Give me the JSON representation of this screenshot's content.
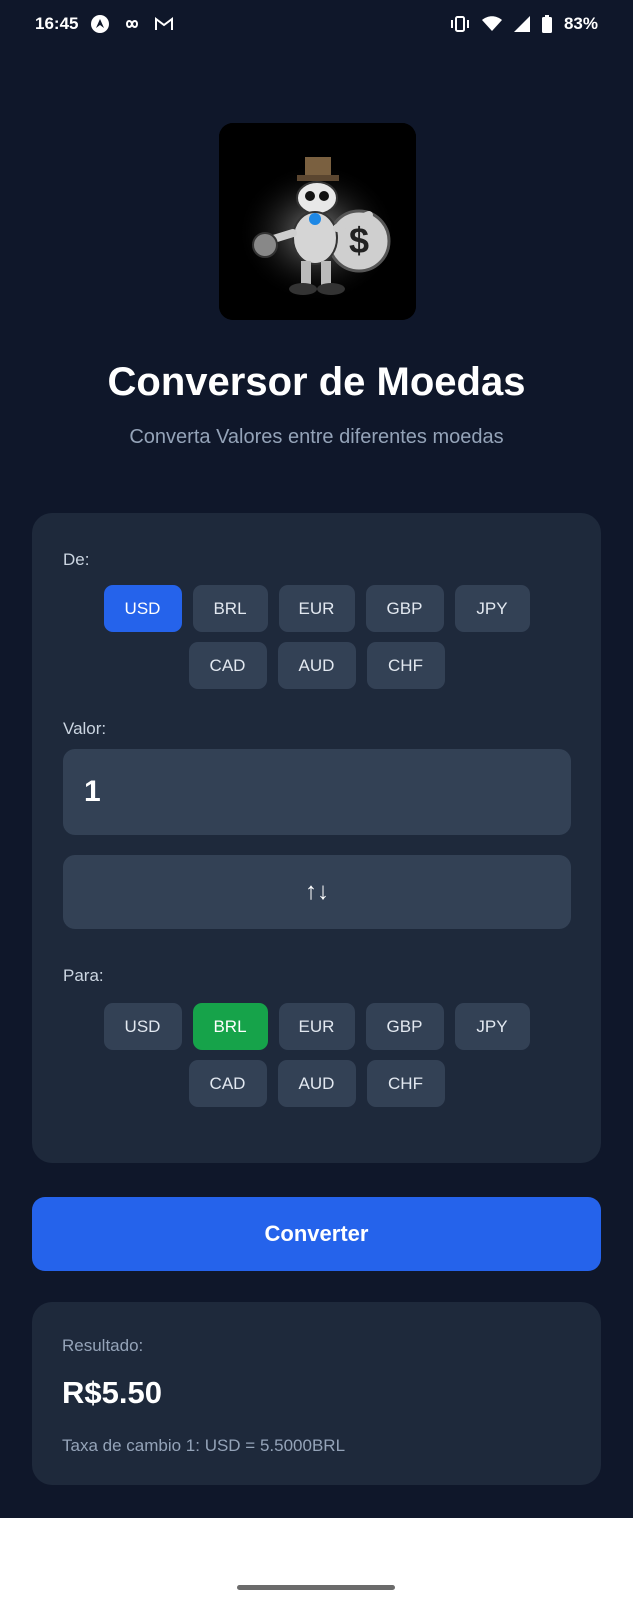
{
  "status_bar": {
    "time": "16:45",
    "battery": "83%",
    "left_icons": [
      "android-auto-icon",
      "infinity-icon",
      "gmail-icon"
    ],
    "right_icons": [
      "vibrate-icon",
      "wifi-icon",
      "signal-icon",
      "battery-icon"
    ]
  },
  "header": {
    "title": "Conversor de Moedas",
    "subtitle": "Converta Valores entre diferentes moedas"
  },
  "converter": {
    "from_label": "De:",
    "to_label": "Para:",
    "value_label": "Valor:",
    "value": "1",
    "swap_icon": "↑↓",
    "currencies_row1": [
      "USD",
      "BRL",
      "EUR",
      "GBP",
      "JPY"
    ],
    "currencies_row2": [
      "CAD",
      "AUD",
      "CHF"
    ],
    "selected_from": "USD",
    "selected_to": "BRL"
  },
  "convert_button": {
    "label": "Converter"
  },
  "result": {
    "label": "Resultado:",
    "value": "R$5.50",
    "rate": "Taxa de cambio 1: USD = 5.5000BRL"
  },
  "colors": {
    "background": "#0f172a",
    "card": "#1e293b",
    "chip": "#334155",
    "from_selected": "#2563eb",
    "to_selected": "#16a34a",
    "primary_button": "#2563eb"
  }
}
